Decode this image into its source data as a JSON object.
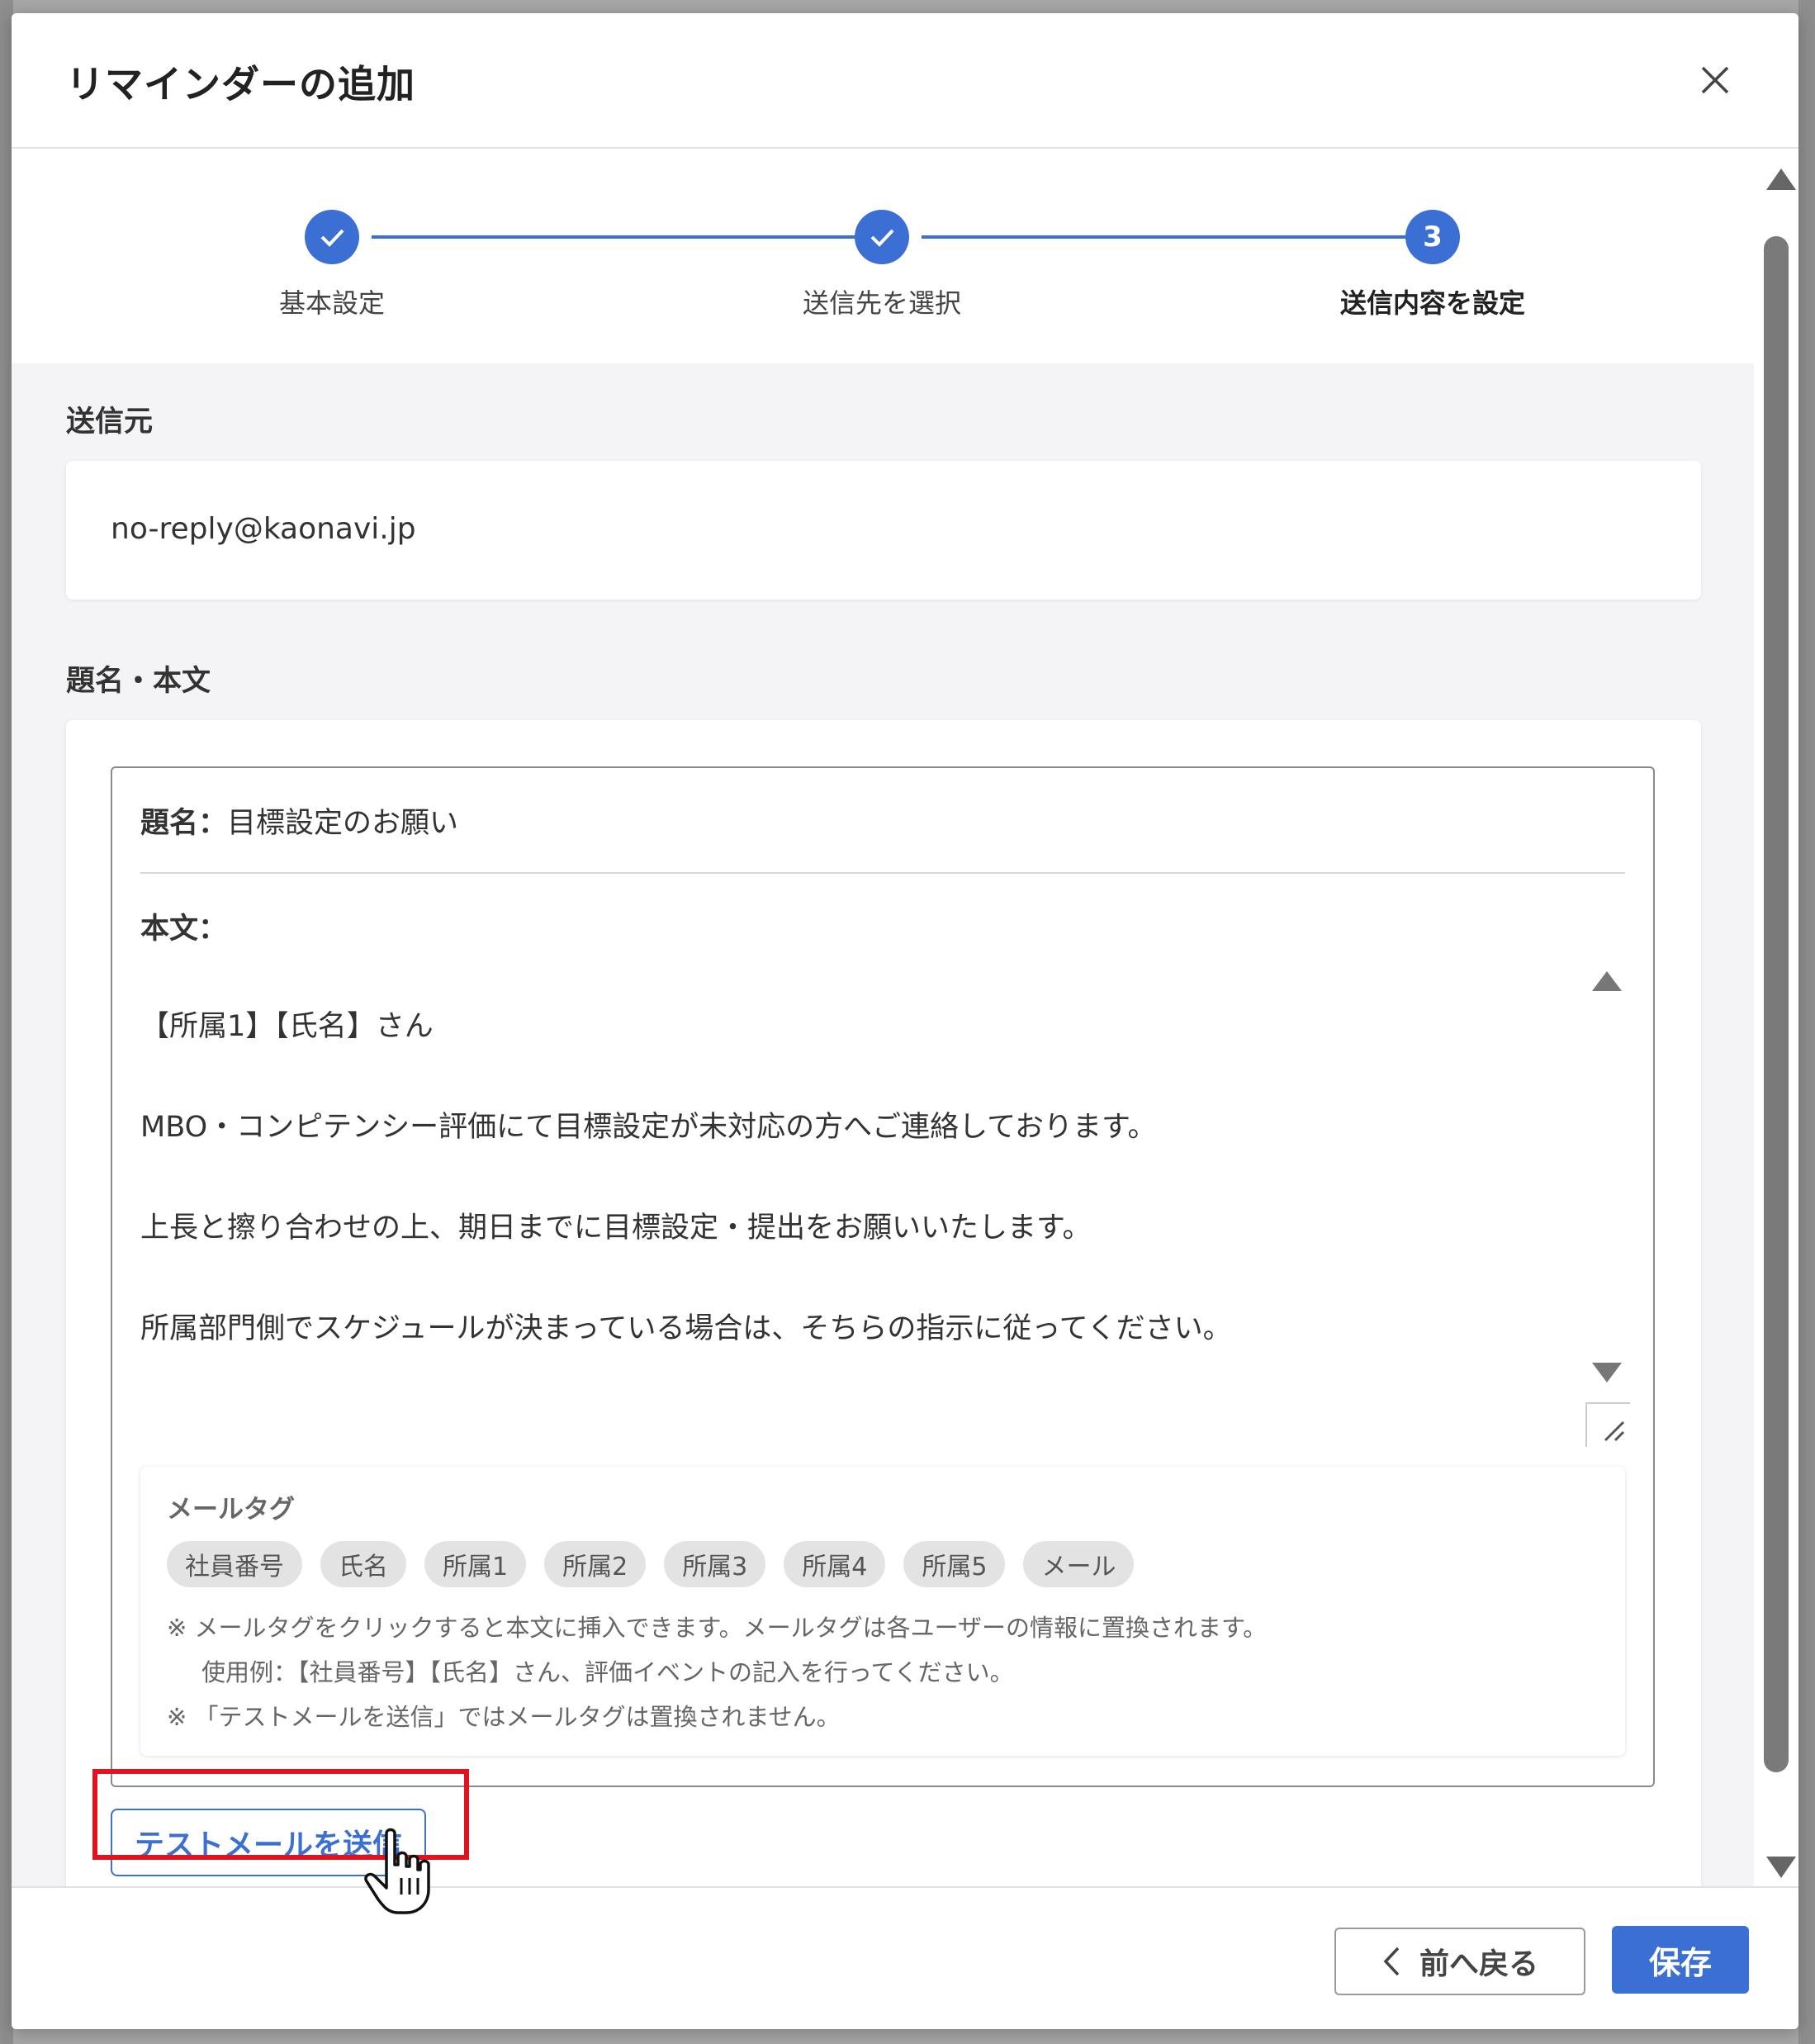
{
  "dialog": {
    "title": "リマインダーの追加"
  },
  "stepper": {
    "steps": [
      {
        "label": "基本設定",
        "state": "done"
      },
      {
        "label": "送信先を選択",
        "state": "done"
      },
      {
        "label": "送信内容を設定",
        "state": "active",
        "number": "3"
      }
    ]
  },
  "sender": {
    "label": "送信元",
    "value": "no-reply@kaonavi.jp"
  },
  "content": {
    "label": "題名・本文",
    "subject_label": "題名：",
    "subject_value": "目標設定のお願い",
    "body_label": "本文：",
    "body_lines": [
      "【所属1】【氏名】さん",
      "MBO・コンピテンシー評価にて目標設定が未対応の方へご連絡しております。",
      "上長と擦り合わせの上、期日までに目標設定・提出をお願いいたします。",
      "所属部門側でスケジュールが決まっている場合は、そちらの指示に従ってください。"
    ]
  },
  "mail_tags": {
    "title": "メールタグ",
    "tags": [
      "社員番号",
      "氏名",
      "所属1",
      "所属2",
      "所属3",
      "所属4",
      "所属5",
      "メール"
    ],
    "note1": "※ メールタグをクリックすると本文に挿入できます。メールタグは各ユーザーの情報に置換されます。",
    "note2": "使用例：【社員番号】【氏名】さん、評価イベントの記入を行ってください。",
    "note3": "※ 「テストメールを送信」ではメールタグは置換されません。"
  },
  "actions": {
    "test_mail": "テストメールを送信",
    "back": "前へ戻る",
    "save": "保存"
  },
  "colors": {
    "accent": "#3b6fd4",
    "highlight": "#e0141e"
  }
}
